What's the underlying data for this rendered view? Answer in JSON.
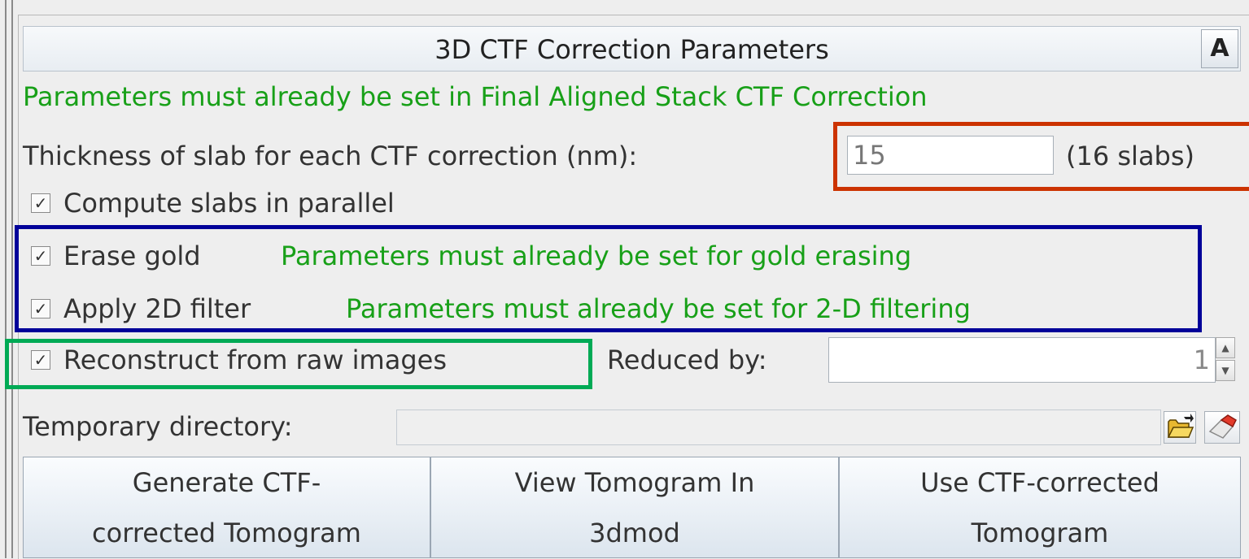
{
  "panel": {
    "title": "3D CTF Correction Parameters",
    "advanced_label": "A",
    "note": "Parameters must already be set in Final Aligned Stack CTF Correction"
  },
  "thickness": {
    "label": "Thickness of slab for each CTF correction (nm):",
    "value": "15",
    "slabs": "(16 slabs)"
  },
  "checkboxes": {
    "parallel": {
      "label": "Compute slabs in parallel",
      "checked": true
    },
    "erase_gold": {
      "label": "Erase gold",
      "checked": true,
      "note": "Parameters must already be set for gold erasing"
    },
    "filter_2d": {
      "label": "Apply 2D filter",
      "checked": true,
      "note": "Parameters must already be set for 2-D filtering"
    },
    "raw_images": {
      "label": "Reconstruct from raw images",
      "checked": true
    }
  },
  "reduced": {
    "label": "Reduced by:",
    "value": "1"
  },
  "temp_dir": {
    "label": "Temporary directory:",
    "value": ""
  },
  "buttons": {
    "generate": [
      "Generate CTF-",
      "corrected Tomogram"
    ],
    "view": [
      "View Tomogram In",
      "3dmod"
    ],
    "use": [
      "Use CTF-corrected",
      "Tomogram"
    ]
  },
  "icons": {
    "folder": "folder-open-icon",
    "eraser": "eraser-icon",
    "check": "checkmark-icon"
  },
  "colors": {
    "note_green": "#18a018",
    "highlight_red": "#cc3300",
    "highlight_blue": "#000099",
    "highlight_green": "#00aa55"
  }
}
